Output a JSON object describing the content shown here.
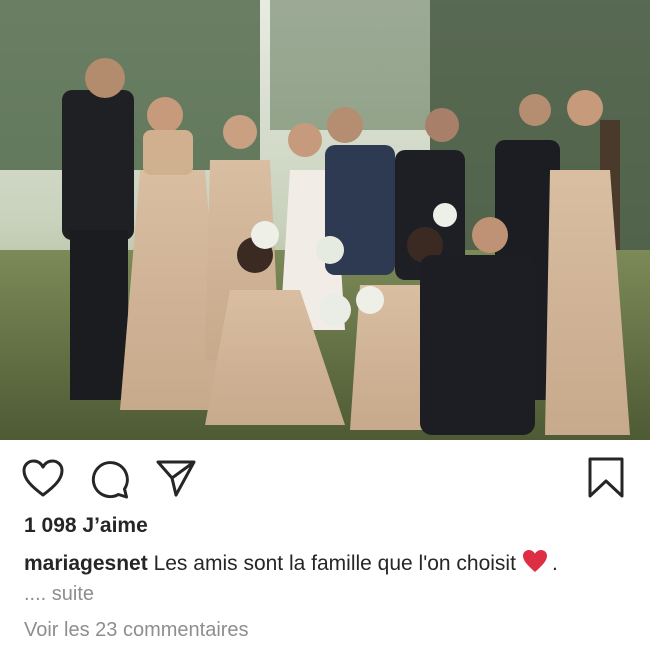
{
  "post": {
    "image_description": "wedding-party-photo",
    "likes_text": "1 098 J’aime",
    "caption": {
      "username": "mariagesnet",
      "text": "Les amis sont la famille que l'on choisit",
      "emoji": "heart-emoji",
      "trailing": "."
    },
    "more_text": ".... suite",
    "view_comments_text": "Voir les 23 commentaires"
  },
  "actions": {
    "icons": [
      "heart-outline-icon",
      "comment-icon",
      "share-paper-plane-icon",
      "bookmark-icon"
    ]
  },
  "colors": {
    "text_primary": "#262626",
    "text_secondary": "#8e8e8e",
    "emoji_heart": "#dd2e44"
  }
}
